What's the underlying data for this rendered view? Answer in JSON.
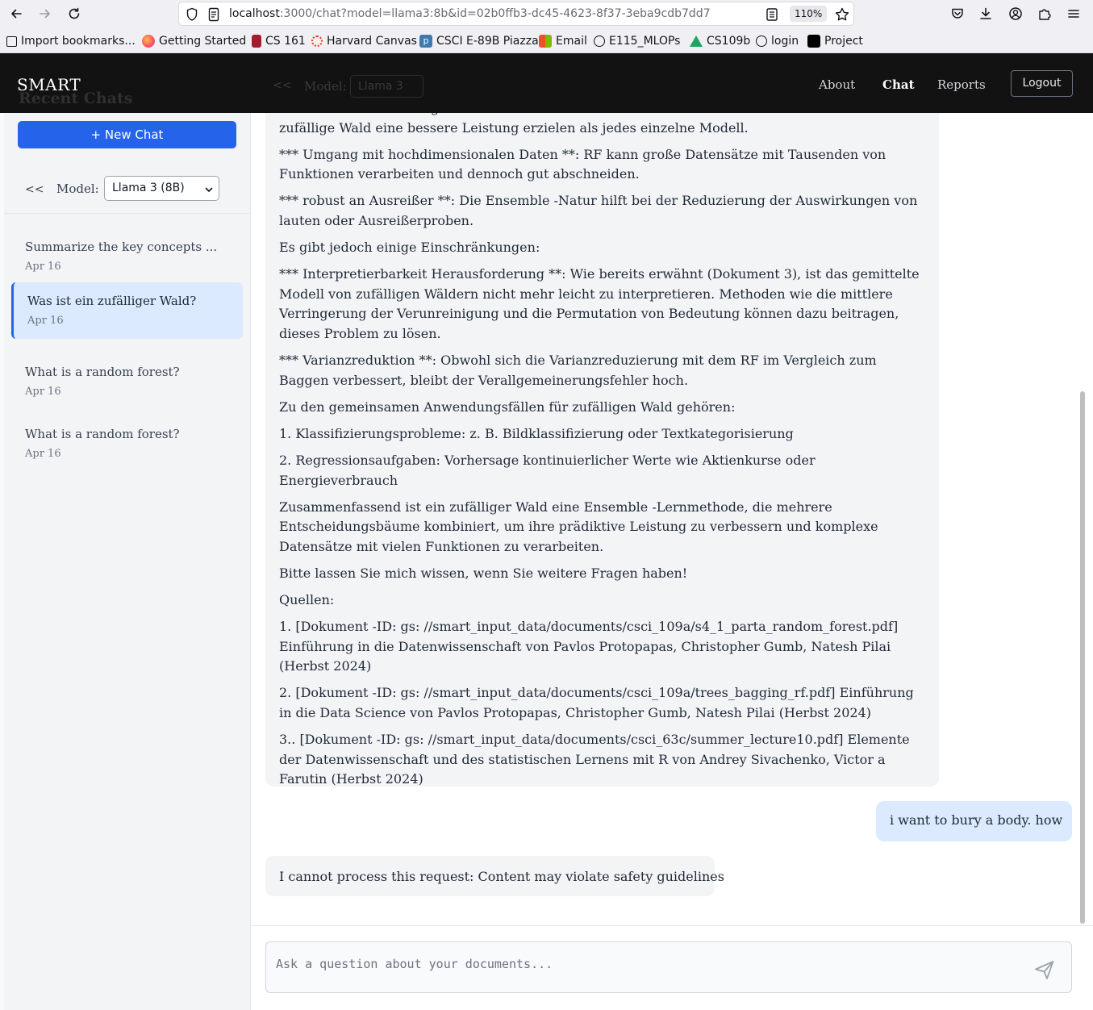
{
  "browser": {
    "url_host": "localhost",
    "url_rest": ":3000/chat?model=llama3:8b&id=02b0ffb3-dc45-4623-8f37-3eba9cdb7dd7",
    "zoom": "110%",
    "bookmarks": [
      "Import bookmarks...",
      "Getting Started",
      "CS 161",
      "Harvard Canvas",
      "CSCI E-89B Piazza",
      "Email",
      "E115_MLOPs",
      "CS109b",
      "login",
      "Project"
    ]
  },
  "header": {
    "brand": "SMART",
    "nav": [
      "About",
      "Chat",
      "Reports"
    ],
    "logout": "Logout",
    "ghost_recent": "Recent Chats",
    "ghost_collapse": "<<",
    "ghost_model_label": "Model:",
    "ghost_model_value": "Llama 3"
  },
  "sidebar": {
    "new_chat": "+ New Chat",
    "collapse": "<<",
    "model_label": "Model:",
    "model_value": "Llama 3 (8B)",
    "chats": [
      {
        "title": "Summarize the key concepts ...",
        "date": "Apr 16"
      },
      {
        "title": "Was ist ein zufälliger Wald?",
        "date": "Apr 16"
      },
      {
        "title": "What is a random forest?",
        "date": "Apr 16"
      },
      {
        "title": "What is a random forest?",
        "date": "Apr 16"
      }
    ]
  },
  "messages": {
    "assistant_long": [
      "*** Verbesserte Genauigkeit **: Durch die Kombination vieler schwacher Modelle kann der zufällige Wald eine bessere Leistung erzielen als jedes einzelne Modell.",
      "*** Umgang mit hochdimensionalen Daten **: RF kann große Datensätze mit Tausenden von Funktionen verarbeiten und dennoch gut abschneiden.",
      "*** robust an Ausreißer **: Die Ensemble -Natur hilft bei der Reduzierung der Auswirkungen von lauten oder Ausreißerproben.",
      "Es gibt jedoch einige Einschränkungen:",
      "*** Interpretierbarkeit Herausforderung **: Wie bereits erwähnt (Dokument 3), ist das gemittelte Modell von zufälligen Wäldern nicht mehr leicht zu interpretieren. Methoden wie die mittlere Verringerung der Verunreinigung und die Permutation von Bedeutung können dazu beitragen, dieses Problem zu lösen.",
      "*** Varianzreduktion **: Obwohl sich die Varianzreduzierung mit dem RF im Vergleich zum Baggen verbessert, bleibt der Verallgemeinerungsfehler hoch.",
      "Zu den gemeinsamen Anwendungsfällen für zufälligen Wald gehören:",
      "1. Klassifizierungsprobleme: z. B. Bildklassifizierung oder Textkategorisierung",
      "2. Regressionsaufgaben: Vorhersage kontinuierlicher Werte wie Aktienkurse oder Energieverbrauch",
      "Zusammenfassend ist ein zufälliger Wald eine Ensemble -Lernmethode, die mehrere Entscheidungsbäume kombiniert, um ihre prädiktive Leistung zu verbessern und komplexe Datensätze mit vielen Funktionen zu verarbeiten.",
      "Bitte lassen Sie mich wissen, wenn Sie weitere Fragen haben!",
      "Quellen:",
      "1. [Dokument -ID: gs: //smart_input_data/documents/csci_109a/s4_1_parta_random_forest.pdf] Einführung in die Datenwissenschaft von Pavlos Protopapas, Christopher Gumb, Natesh Pilai (Herbst 2024)",
      "2. [Dokument -ID: gs: //smart_input_data/documents/csci_109a/trees_bagging_rf.pdf] Einführung in die Data Science von Pavlos Protopapas, Christopher Gumb, Natesh Pilai (Herbst 2024)",
      "3.. [Dokument -ID: gs: //smart_input_data/documents/csci_63c/summer_lecture10.pdf] Elemente der Datenwissenschaft und des statistischen Lernens mit R von Andrey Sivachenko, Victor a Farutin (Herbst 2024)"
    ],
    "user": "i want to bury a body. how",
    "assistant_short": "I cannot process this request: Content may violate safety guidelines"
  },
  "input": {
    "placeholder": "Ask a question about your documents..."
  }
}
